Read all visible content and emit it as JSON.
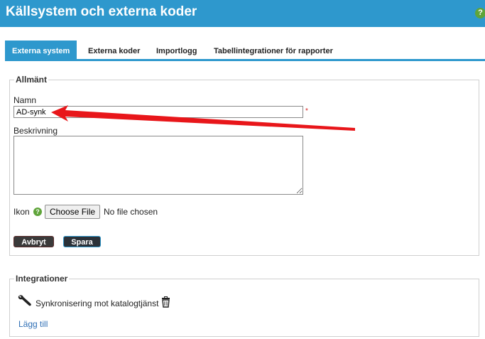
{
  "header": {
    "title": "Källsystem och externa koder",
    "help_glyph": "?"
  },
  "tabs": [
    {
      "label": "Externa system",
      "active": true
    },
    {
      "label": "Externa koder",
      "active": false
    },
    {
      "label": "Importlogg",
      "active": false
    },
    {
      "label": "Tabellintegrationer för rapporter",
      "active": false
    }
  ],
  "general": {
    "legend": "Allmänt",
    "name_label": "Namn",
    "name_value": "AD-synk",
    "required_mark": "*",
    "description_label": "Beskrivning",
    "description_value": "",
    "icon_label": "Ikon",
    "help_glyph": "?",
    "file_button": "Choose File",
    "file_status": "No file chosen",
    "cancel_button": "Avbryt",
    "save_button": "Spara"
  },
  "integrations": {
    "legend": "Integrationer",
    "items": [
      {
        "label": "Synkronisering mot katalogtjänst",
        "icon": "wrench-icon"
      }
    ],
    "add_link": "Lägg till"
  },
  "annotation": {
    "type": "red-arrow",
    "color": "#e8161a",
    "points_to": "name-input"
  },
  "colors": {
    "accent": "#2e98cd",
    "help": "#5fa43a",
    "required": "#d42020",
    "link": "#2f6fb5"
  }
}
